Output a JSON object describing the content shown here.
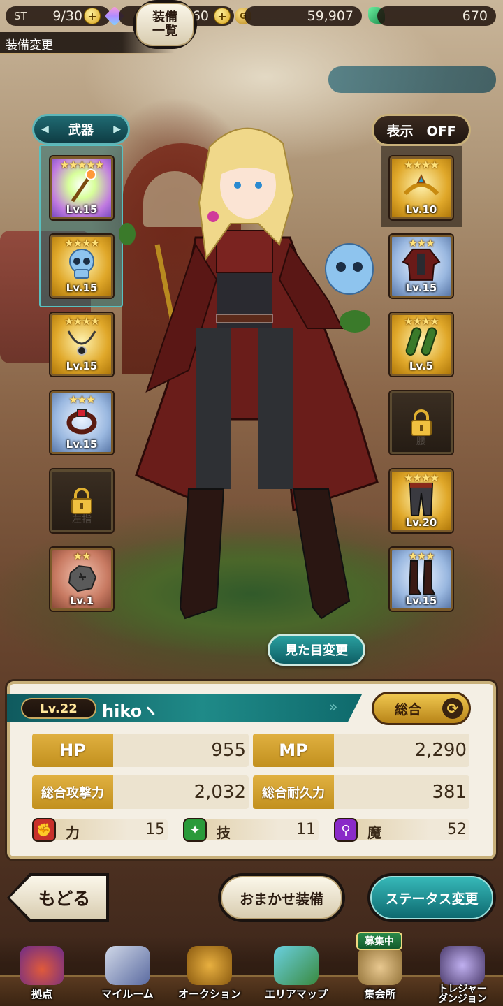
{
  "status_bar": {
    "stamina_label": "ST",
    "stamina": "9/30",
    "gems": "660",
    "gold": "59,907",
    "emeralds": "670"
  },
  "screen_title": "装備変更",
  "tabs": {
    "weapon": "武器",
    "display_toggle": "表示　OFF"
  },
  "left_slots": [
    {
      "stars": "★★★★★",
      "level": "Lv.15",
      "icon": "staff-icon"
    },
    {
      "stars": "★★★★",
      "level": "Lv.15",
      "icon": "skull-icon"
    },
    {
      "stars": "★★★★",
      "level": "Lv.15",
      "icon": "necklace-icon"
    },
    {
      "stars": "★★★",
      "level": "Lv.15",
      "icon": "bracelet-icon"
    },
    {
      "stars": "",
      "level": "",
      "icon": "lock-icon",
      "ghost": "左指"
    },
    {
      "stars": "★★",
      "level": "Lv.1",
      "icon": "stone-icon"
    }
  ],
  "right_slots": [
    {
      "stars": "★★★★",
      "level": "Lv.10",
      "icon": "tiara-icon"
    },
    {
      "stars": "★★★",
      "level": "Lv.15",
      "icon": "coat-icon"
    },
    {
      "stars": "★★★★",
      "level": "Lv.5",
      "icon": "gloves-icon"
    },
    {
      "stars": "",
      "level": "",
      "icon": "lock-icon",
      "ghost": "腰"
    },
    {
      "stars": "★★★★",
      "level": "Lv.20",
      "icon": "pants-icon"
    },
    {
      "stars": "★★★",
      "level": "Lv.15",
      "icon": "boots-icon"
    }
  ],
  "look_change_label": "見た目変更",
  "player": {
    "level": "Lv.22",
    "name": "hikoヽ"
  },
  "overall_button": "総合",
  "stats": {
    "hp_label": "HP",
    "hp": "955",
    "mp_label": "MP",
    "mp": "2,290",
    "atk_label": "総合攻撃力",
    "atk": "2,032",
    "def_label": "総合耐久力",
    "def": "381",
    "str_label": "力",
    "str": "15",
    "tech_label": "技",
    "tech": "11",
    "magic_label": "魔",
    "magic": "52"
  },
  "actions": {
    "back": "もどる",
    "equipment_list_line1": "装備",
    "equipment_list_line2": "一覧",
    "auto_equip": "おまかせ装備",
    "status_change": "ステータス変更"
  },
  "nav": {
    "base": "拠点",
    "my_room": "マイルーム",
    "auction": "オークション",
    "area_map": "エリアマップ",
    "guild_hall": "集会所",
    "treasure_line1": "トレジャー",
    "treasure_line2": "ダンジョン",
    "recruit_badge": "募集中"
  },
  "colors": {
    "accent_teal": "#1f8a88",
    "gold_frame": "#e0a82a",
    "panel_bg": "#f4efe4"
  }
}
